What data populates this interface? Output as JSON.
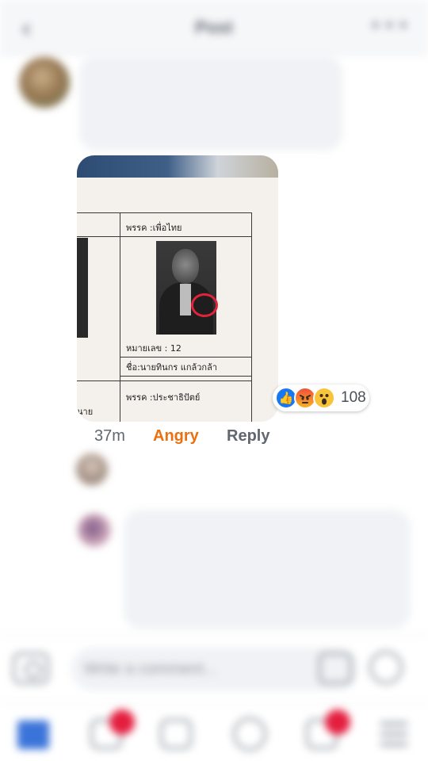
{
  "header": {
    "title": "Post",
    "back_icon": "chevron-left-icon",
    "more_icon": "more-icon"
  },
  "comment1": {
    "author": "",
    "lines": [
      "",
      ""
    ]
  },
  "photo": {
    "party_top": "พรรค :เพื่อไทย",
    "number": "หมายเลข : 12",
    "name": "ชื่อ:นายทินกร  แกล้วกล้า",
    "party_bottom": "พรรค :ประชาธิปัตย์",
    "left_fragment": "นาย"
  },
  "reactions": {
    "icons": [
      "like-icon",
      "angry-icon",
      "wow-icon"
    ],
    "count": "108",
    "like_color": "#1877f2"
  },
  "meta": {
    "time": "37m",
    "reaction": "Angry",
    "reply": "Reply",
    "reaction_color": "#e9710f"
  },
  "reply_preview": {
    "author": "",
    "count": ""
  },
  "comment2": {
    "author": "",
    "lines": [
      "",
      "",
      ""
    ]
  },
  "composer": {
    "placeholder": "Write a comment..."
  },
  "nav": {
    "badge_color": "#e41e3f",
    "feed_color": "#3b74d9"
  }
}
